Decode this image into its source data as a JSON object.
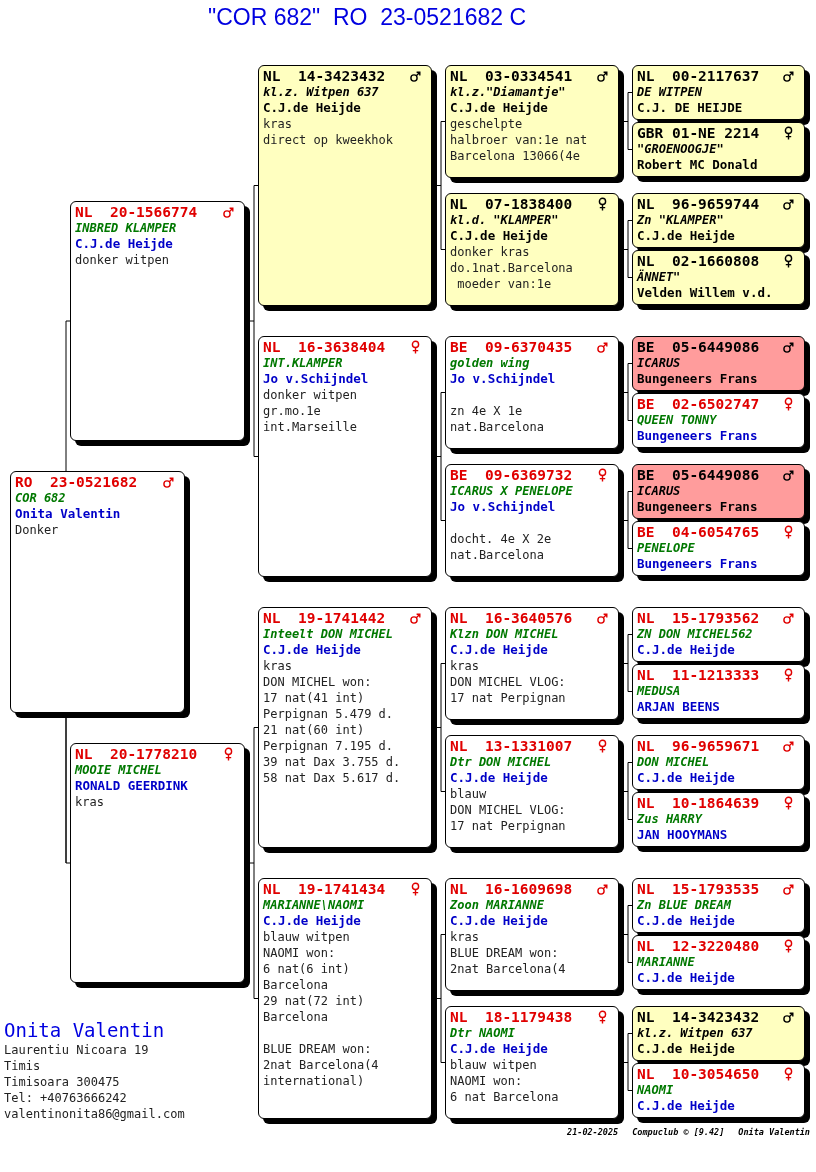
{
  "title": "\"COR 682\"  RO  23-0521682 C",
  "pedigree": {
    "ring": "RO  23-0521682",
    "male": true,
    "name": "COR 682",
    "owner": "Onita Valentin",
    "plumage": "Donker",
    "color": "#ffffff",
    "parents": [
      {
        "ring": "NL  20-1566774",
        "male": true,
        "name": "INBRED KLAMPER",
        "owner": "C.J.de Heijde",
        "plumage": "donker witpen",
        "color": "#ffffff",
        "parents": [
          {
            "ring": "NL  14-3423432",
            "male": true,
            "name": "kl.z. Witpen 637",
            "owner": "C.J.de Heijde",
            "plumage": "kras",
            "notes": [
              [
                "direct op kweekhok"
              ]
            ],
            "color": "#ffffc0",
            "parents": [
              {
                "ring": "NL  03-0334541",
                "male": true,
                "name": "kl.z.\"Diamantje\"",
                "owner": "C.J.de Heijde",
                "plumage": "geschelpte",
                "notes": [
                  [
                    "halbroer van:1e nat",
                    "Barcelona 13066(4e"
                  ]
                ],
                "color": "#ffffc0",
                "parents": [
                  {
                    "ring": "NL  00-2117637",
                    "male": true,
                    "name": "DE WITPEN",
                    "owner": "C.J. DE HEIJDE",
                    "color": "#ffffc0"
                  },
                  {
                    "ring": "GBR 01-NE 2214",
                    "male": false,
                    "name": "\"GROENOOGJE\"",
                    "owner": "Robert MC Donald",
                    "color": "#ffffc0"
                  }
                ]
              },
              {
                "ring": "NL  07-1838400",
                "male": false,
                "name": "kl.d. \"KLAMPER\"",
                "owner": "C.J.de Heijde",
                "plumage": "donker kras",
                "notes": [
                  [
                    "do.1nat.Barcelona",
                    " moeder van:1e"
                  ]
                ],
                "color": "#ffffc0",
                "parents": [
                  {
                    "ring": "NL  96-9659744",
                    "male": true,
                    "name": "Zn \"KLAMPER\"",
                    "owner": "C.J.de Heijde",
                    "color": "#ffffc0"
                  },
                  {
                    "ring": "NL  02-1660808",
                    "male": false,
                    "name": "ÄNNET\"",
                    "owner": "Velden Willem v.d.",
                    "color": "#ffffc0"
                  }
                ]
              }
            ]
          },
          {
            "ring": "NL  16-3638404",
            "male": false,
            "name": "INT.KLAMPER",
            "owner": "Jo v.Schijndel",
            "plumage": "donker witpen",
            "notes": [
              [
                "gr.mo.1e",
                "int.Marseille"
              ]
            ],
            "color": "#ffffff",
            "parents": [
              {
                "ring": "BE  09-6370435",
                "male": true,
                "name": "golden wing",
                "owner": "Jo v.Schijndel",
                "notes": [
                  [
                    "zn 4e X 1e",
                    "nat.Barcelona"
                  ]
                ],
                "color": "#ffffff",
                "parents": [
                  {
                    "ring": "BE  05-6449086",
                    "male": true,
                    "name": "ICARUS",
                    "owner": "Bungeneers Frans",
                    "color": "#ff9c9c"
                  },
                  {
                    "ring": "BE  02-6502747",
                    "male": false,
                    "name": "QUEEN TONNY",
                    "owner": "Bungeneers Frans",
                    "color": "#ffffff"
                  }
                ]
              },
              {
                "ring": "BE  09-6369732",
                "male": false,
                "name": "ICARUS X PENELOPE",
                "owner": "Jo v.Schijndel",
                "notes": [
                  [
                    "docht. 4e X 2e",
                    "nat.Barcelona"
                  ]
                ],
                "color": "#ffffff",
                "parents": [
                  {
                    "ring": "BE  05-6449086",
                    "male": true,
                    "name": "ICARUS",
                    "owner": "Bungeneers Frans",
                    "color": "#ff9c9c"
                  },
                  {
                    "ring": "BE  04-6054765",
                    "male": false,
                    "name": "PENELOPE",
                    "owner": "Bungeneers Frans",
                    "color": "#ffffff"
                  }
                ]
              }
            ]
          }
        ]
      },
      {
        "ring": "NL  20-1778210",
        "male": false,
        "name": "MOOIE MICHEL",
        "owner": "RONALD GEERDINK",
        "plumage": "kras",
        "color": "#ffffff",
        "parents": [
          {
            "ring": "NL  19-1741442",
            "male": true,
            "name": "Inteelt DON MICHEL",
            "owner": "C.J.de Heijde",
            "plumage": "kras",
            "notes": [
              [
                "DON MICHEL won:",
                "17 nat(41 int)",
                "Perpignan 5.479 d.",
                "21 nat(60 int)",
                "Perpignan 7.195 d.",
                "39 nat Dax 3.755 d.",
                "58 nat Dax 5.617 d."
              ]
            ],
            "color": "#ffffff",
            "parents": [
              {
                "ring": "NL  16-3640576",
                "male": true,
                "name": "Klzn DON MICHEL",
                "owner": "C.J.de Heijde",
                "plumage": "kras",
                "notes": [
                  [
                    "DON MICHEL VLOG:",
                    "17 nat Perpignan"
                  ]
                ],
                "color": "#ffffff",
                "parents": [
                  {
                    "ring": "NL  15-1793562",
                    "male": true,
                    "name": "ZN DON MICHEL562",
                    "owner": "C.J.de Heijde",
                    "color": "#ffffff"
                  },
                  {
                    "ring": "NL  11-1213333",
                    "male": false,
                    "name": "MEDUSA",
                    "owner": "ARJAN BEENS",
                    "color": "#ffffff"
                  }
                ]
              },
              {
                "ring": "NL  13-1331007",
                "male": false,
                "name": "Dtr DON MICHEL",
                "owner": "C.J.de Heijde",
                "plumage": "blauw",
                "notes": [
                  [
                    "DON MICHEL VLOG:",
                    "17 nat Perpignan"
                  ]
                ],
                "color": "#ffffff",
                "parents": [
                  {
                    "ring": "NL  96-9659671",
                    "male": true,
                    "name": "DON MICHEL",
                    "owner": "C.J.de Heijde",
                    "color": "#ffffff"
                  },
                  {
                    "ring": "NL  10-1864639",
                    "male": false,
                    "name": "Zus HARRY",
                    "owner": "JAN HOOYMANS",
                    "color": "#ffffff"
                  }
                ]
              }
            ]
          },
          {
            "ring": "NL  19-1741434",
            "male": false,
            "name": "MARIANNE\\NAOMI",
            "owner": "C.J.de Heijde",
            "plumage": "blauw witpen",
            "notes": [
              [
                "NAOMI won:",
                "6 nat(6 int)",
                "Barcelona",
                "29 nat(72 int)",
                "Barcelona"
              ],
              [
                "BLUE DREAM won:",
                "2nat Barcelona(4",
                "international)"
              ]
            ],
            "color": "#ffffff",
            "parents": [
              {
                "ring": "NL  16-1609698",
                "male": true,
                "name": "Zoon MARIANNE",
                "owner": "C.J.de Heijde",
                "plumage": "kras",
                "notes": [
                  [
                    "BLUE DREAM won:",
                    "2nat Barcelona(4"
                  ]
                ],
                "color": "#ffffff",
                "parents": [
                  {
                    "ring": "NL  15-1793535",
                    "male": true,
                    "name": "Zn BLUE DREAM",
                    "owner": "C.J.de Heijde",
                    "color": "#ffffff"
                  },
                  {
                    "ring": "NL  12-3220480",
                    "male": false,
                    "name": "MARIANNE",
                    "owner": "C.J.de Heijde",
                    "color": "#ffffff"
                  }
                ]
              },
              {
                "ring": "NL  18-1179438",
                "male": false,
                "name": "Dtr NAOMI",
                "owner": "C.J.de Heijde",
                "plumage": "blauw witpen",
                "notes": [
                  [
                    "NAOMI won:",
                    "6 nat Barcelona"
                  ]
                ],
                "color": "#ffffff",
                "parents": [
                  {
                    "ring": "NL  14-3423432",
                    "male": true,
                    "name": "kl.z. Witpen 637",
                    "owner": "C.J.de Heijde",
                    "color": "#ffffc0"
                  },
                  {
                    "ring": "NL  10-3054650",
                    "male": false,
                    "name": "NAOMI",
                    "owner": "C.J.de Heijde",
                    "color": "#ffffff"
                  }
                ]
              }
            ]
          }
        ]
      }
    ]
  },
  "breeder": {
    "name": "Onita Valentin",
    "lines": [
      "Laurentiu Nicoara 19",
      "Timis",
      "Timisoara 300475",
      "Tel: +40763666242",
      "valentinonita86@gmail.com"
    ]
  },
  "footer": {
    "date": "21-02-2025",
    "program": "Compuclub © [9.42]",
    "user": "Onita Valentin"
  }
}
